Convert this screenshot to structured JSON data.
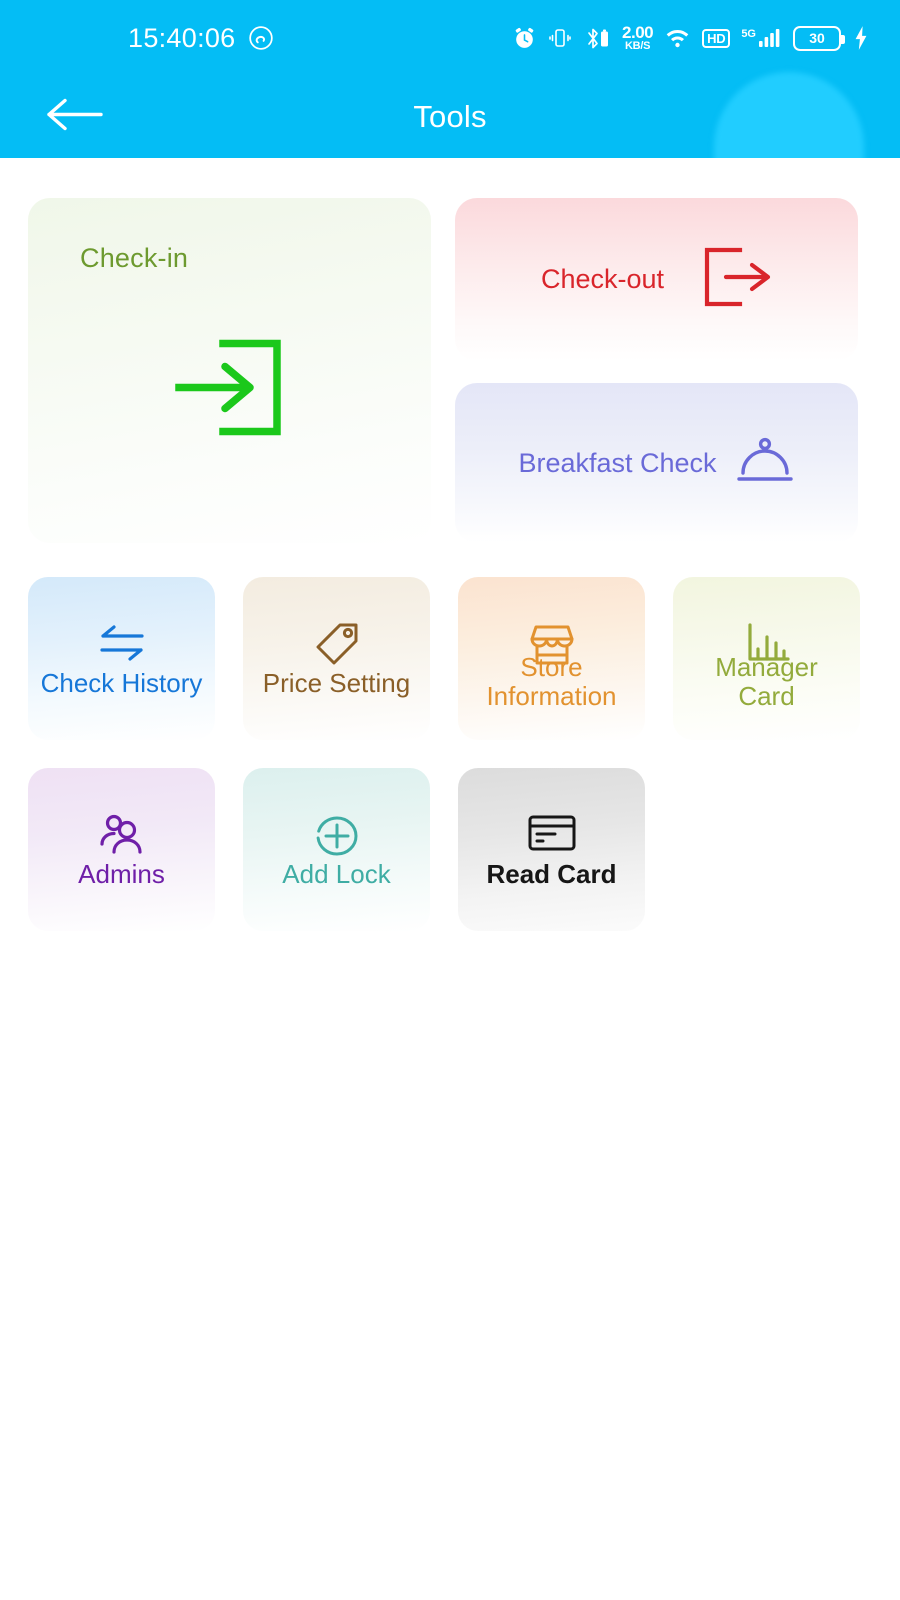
{
  "statusbar": {
    "time": "15:40:06",
    "music_icon": "music-app-icon",
    "alarm_icon": "alarm-clock-icon",
    "vibrate_icon": "vibrate-icon",
    "bluetooth_icon": "bluetooth-battery-icon",
    "net_speed_value": "2.00",
    "net_speed_unit": "KB/S",
    "wifi_icon": "wifi-icon",
    "hd_label": "HD",
    "signal_label": "5G",
    "signal_icon": "cellular-signal-icon",
    "battery_level": "30",
    "charging_icon": "charging-bolt-icon"
  },
  "navbar": {
    "back_icon": "back-arrow-icon",
    "title": "Tools"
  },
  "colors": {
    "header_blue": "#04bdf5",
    "header_blob": "#21cdff",
    "checkin_green": "#6d9a2f",
    "checkin_icon_green": "#1bc81b",
    "checkout_red": "#d9252b",
    "breakfast_indigo": "#6a6ad8",
    "history_blue": "#1677d8",
    "price_brown": "#8a5f28",
    "store_orange": "#e2922f",
    "manager_olive": "#93ab3c",
    "admins_purple": "#6f1fa8",
    "addlock_teal": "#3fada4",
    "readcard_black": "#161616"
  },
  "cards": {
    "checkin": {
      "label": "Check-in",
      "icon": "login-arrow-icon"
    },
    "checkout": {
      "label": "Check-out",
      "icon": "logout-arrow-icon"
    },
    "breakfast": {
      "label": "Breakfast Check",
      "icon": "food-cloche-icon"
    }
  },
  "tiles": [
    {
      "label": "Check History",
      "icon": "swap-arrows-icon",
      "theme": "t-history"
    },
    {
      "label": "Price Setting",
      "icon": "price-tag-icon",
      "theme": "t-price"
    },
    {
      "label": "Store\nInformation",
      "icon": "storefront-icon",
      "theme": "t-store"
    },
    {
      "label": "Manager\nCard",
      "icon": "bar-chart-icon",
      "theme": "t-manager"
    },
    {
      "label": "Admins",
      "icon": "people-icon",
      "theme": "t-admins"
    },
    {
      "label": "Add Lock",
      "icon": "plus-circle-icon",
      "theme": "t-addlock"
    },
    {
      "label": "Read Card",
      "icon": "credit-card-icon",
      "theme": "t-readcard"
    }
  ]
}
